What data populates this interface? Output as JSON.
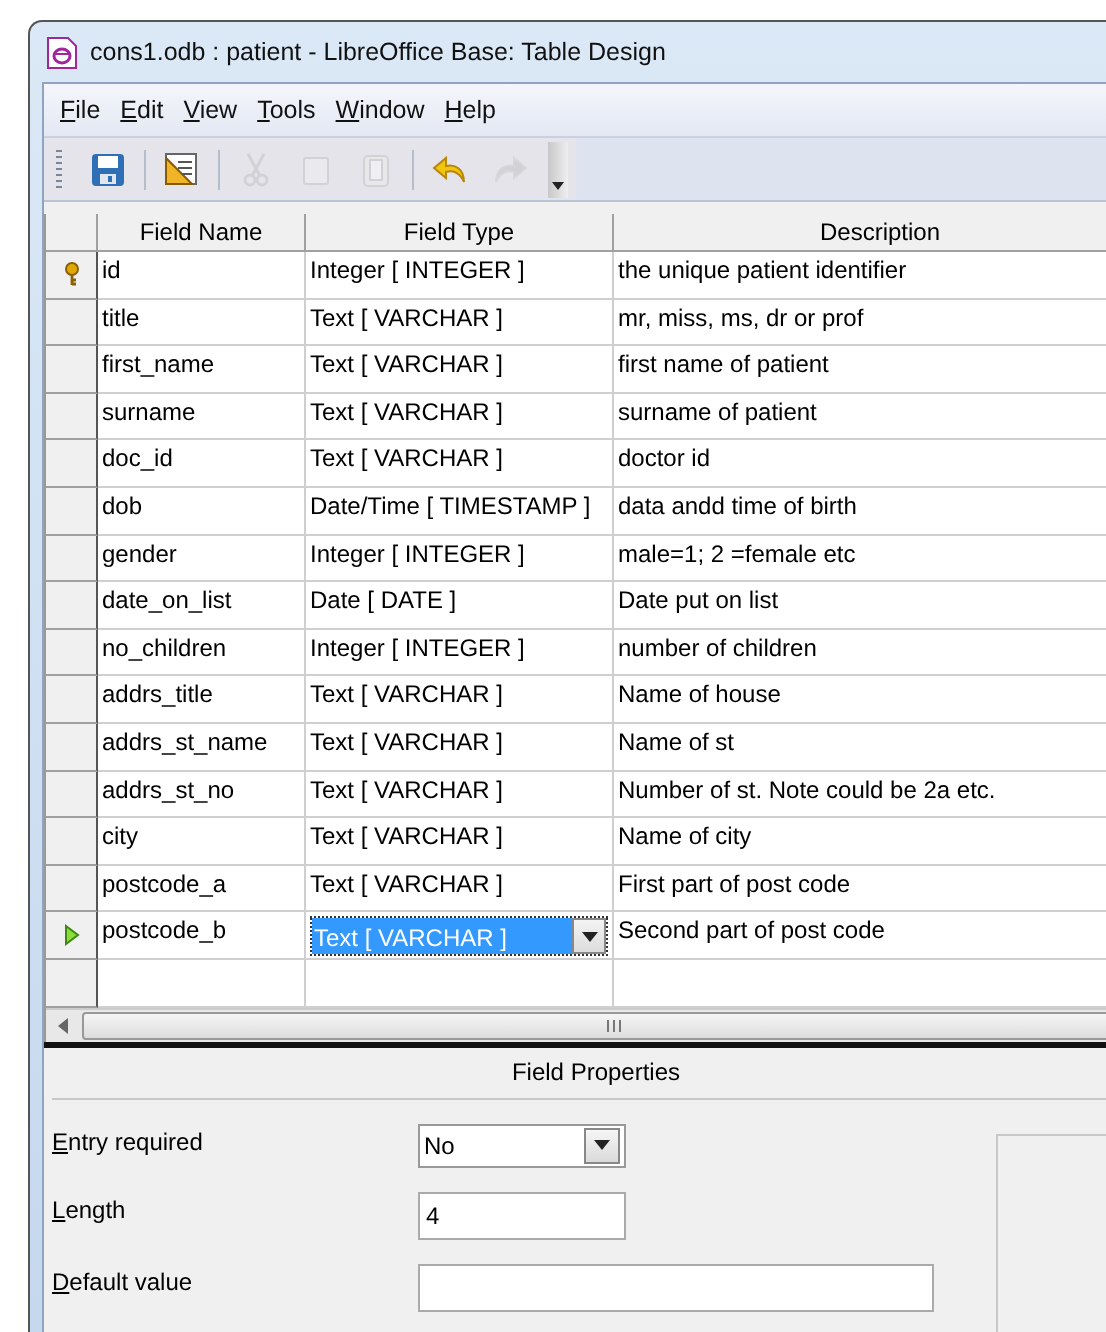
{
  "window": {
    "title": "cons1.odb : patient - LibreOffice Base: Table Design"
  },
  "menu": [
    {
      "label": "File"
    },
    {
      "label": "Edit"
    },
    {
      "label": "View"
    },
    {
      "label": "Tools"
    },
    {
      "label": "Window"
    },
    {
      "label": "Help"
    }
  ],
  "toolbar": [
    {
      "kind": "save",
      "disabled": false
    },
    {
      "kind": "separator"
    },
    {
      "kind": "design",
      "disabled": false
    },
    {
      "kind": "separator"
    },
    {
      "kind": "cut",
      "disabled": true
    },
    {
      "kind": "copy",
      "disabled": true
    },
    {
      "kind": "paste",
      "disabled": true
    },
    {
      "kind": "separator"
    },
    {
      "kind": "undo",
      "disabled": false
    },
    {
      "kind": "redo",
      "disabled": true
    },
    {
      "kind": "overflow"
    }
  ],
  "table": {
    "columns": [
      "Field Name",
      "Field Type",
      "Description"
    ],
    "rows": [
      {
        "primary_key": true,
        "current": false,
        "name": "id",
        "type": "Integer [ INTEGER ]",
        "description": "the unique patient identifier",
        "editing": false
      },
      {
        "primary_key": false,
        "current": false,
        "name": "title",
        "type": "Text [ VARCHAR ]",
        "description": "mr, miss, ms, dr or prof",
        "editing": false
      },
      {
        "primary_key": false,
        "current": false,
        "name": "first_name",
        "type": "Text [ VARCHAR ]",
        "description": "first name of patient",
        "editing": false
      },
      {
        "primary_key": false,
        "current": false,
        "name": "surname",
        "type": "Text [ VARCHAR ]",
        "description": "surname of patient",
        "editing": false
      },
      {
        "primary_key": false,
        "current": false,
        "name": "doc_id",
        "type": "Text [ VARCHAR ]",
        "description": "doctor id",
        "editing": false
      },
      {
        "primary_key": false,
        "current": false,
        "name": "dob",
        "type": "Date/Time [ TIMESTAMP ]",
        "description": "data andd time of birth",
        "editing": false
      },
      {
        "primary_key": false,
        "current": false,
        "name": "gender",
        "type": "Integer [ INTEGER ]",
        "description": "male=1; 2 =female etc",
        "editing": false
      },
      {
        "primary_key": false,
        "current": false,
        "name": "date_on_list",
        "type": "Date [ DATE ]",
        "description": "Date put on list",
        "editing": false
      },
      {
        "primary_key": false,
        "current": false,
        "name": "no_children",
        "type": "Integer [ INTEGER ]",
        "description": "number of children",
        "editing": false
      },
      {
        "primary_key": false,
        "current": false,
        "name": "addrs_title",
        "type": "Text [ VARCHAR ]",
        "description": "Name of house",
        "editing": false
      },
      {
        "primary_key": false,
        "current": false,
        "name": "addrs_st_name",
        "type": "Text [ VARCHAR ]",
        "description": "Name of st",
        "editing": false
      },
      {
        "primary_key": false,
        "current": false,
        "name": "addrs_st_no",
        "type": "Text [ VARCHAR ]",
        "description": "Number of st.  Note could be 2a etc.",
        "editing": false
      },
      {
        "primary_key": false,
        "current": false,
        "name": "city",
        "type": "Text [ VARCHAR ]",
        "description": "Name of city",
        "editing": false
      },
      {
        "primary_key": false,
        "current": false,
        "name": "postcode_a",
        "type": "Text [ VARCHAR ]",
        "description": "First part of post code",
        "editing": false
      },
      {
        "primary_key": false,
        "current": true,
        "name": "postcode_b",
        "type": "Text [ VARCHAR ]",
        "description": "Second part of post code",
        "editing": true
      }
    ]
  },
  "field_properties": {
    "title": "Field Properties",
    "fields": [
      {
        "kind": "dropdown",
        "label": "Entry required",
        "value": "No"
      },
      {
        "kind": "text",
        "label": "Length",
        "value": "4"
      },
      {
        "kind": "text",
        "label": "Default value"
      }
    ]
  }
}
